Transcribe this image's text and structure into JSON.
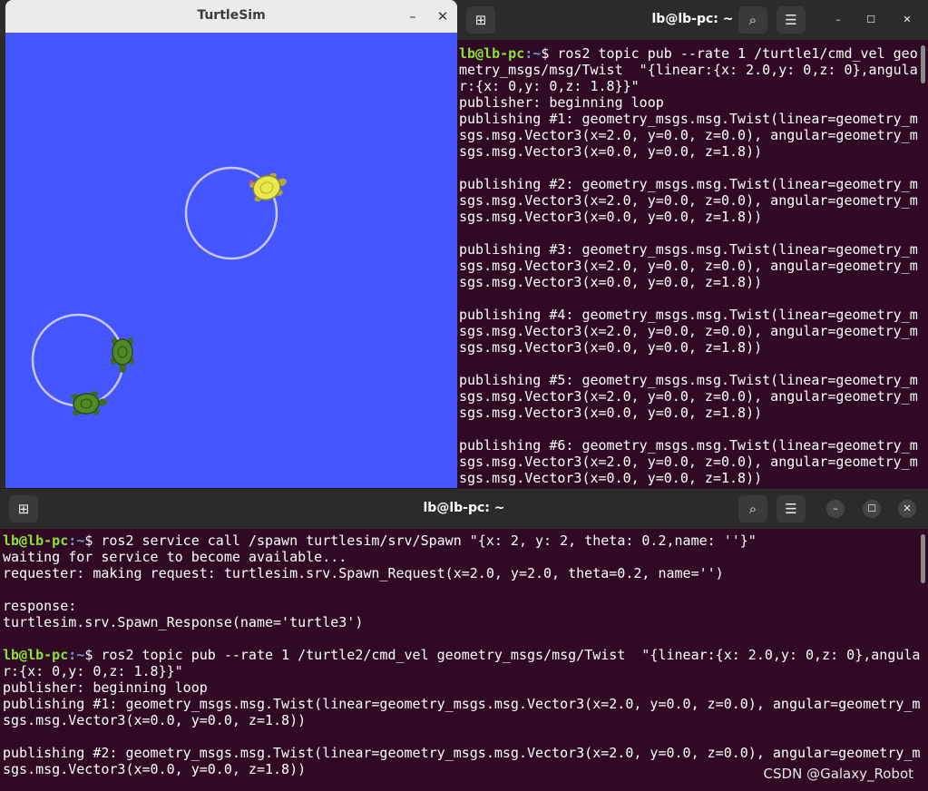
{
  "turtlesim": {
    "title": "TurtleSim",
    "minimize_icon": "minimize-icon",
    "close_icon": "close-icon",
    "background_color": "#4556ff",
    "trail_color": "#c8c8ff"
  },
  "terminal_top": {
    "title": "lb@lb-pc: ~",
    "prompt_user": "lb@lb-pc",
    "prompt_path": ":~",
    "prompt_symbol": "$ ",
    "command": "ros2 topic pub --rate 1 /turtle1/cmd_vel geo",
    "lines": [
      "metry_msgs/msg/Twist  \"{linear:{x: 2.0,y: 0,z: 0},angula",
      "r:{x: 0,y: 0,z: 1.8}}\"",
      "publisher: beginning loop",
      "publishing #1: geometry_msgs.msg.Twist(linear=geometry_m",
      "sgs.msg.Vector3(x=2.0, y=0.0, z=0.0), angular=geometry_m",
      "sgs.msg.Vector3(x=0.0, y=0.0, z=1.8))",
      "",
      "publishing #2: geometry_msgs.msg.Twist(linear=geometry_m",
      "sgs.msg.Vector3(x=2.0, y=0.0, z=0.0), angular=geometry_m",
      "sgs.msg.Vector3(x=0.0, y=0.0, z=1.8))",
      "",
      "publishing #3: geometry_msgs.msg.Twist(linear=geometry_m",
      "sgs.msg.Vector3(x=2.0, y=0.0, z=0.0), angular=geometry_m",
      "sgs.msg.Vector3(x=0.0, y=0.0, z=1.8))",
      "",
      "publishing #4: geometry_msgs.msg.Twist(linear=geometry_m",
      "sgs.msg.Vector3(x=2.0, y=0.0, z=0.0), angular=geometry_m",
      "sgs.msg.Vector3(x=0.0, y=0.0, z=1.8))",
      "",
      "publishing #5: geometry_msgs.msg.Twist(linear=geometry_m",
      "sgs.msg.Vector3(x=2.0, y=0.0, z=0.0), angular=geometry_m",
      "sgs.msg.Vector3(x=0.0, y=0.0, z=1.8))",
      "",
      "publishing #6: geometry_msgs.msg.Twist(linear=geometry_m",
      "sgs.msg.Vector3(x=2.0, y=0.0, z=0.0), angular=geometry_m",
      "sgs.msg.Vector3(x=0.0, y=0.0, z=1.8))"
    ],
    "icons": {
      "new_tab": "new-tab-icon",
      "search": "search-icon",
      "menu": "hamburger-menu-icon",
      "minimize": "minimize-icon",
      "maximize": "maximize-icon",
      "close": "close-icon"
    }
  },
  "terminal_bottom": {
    "title": "lb@lb-pc: ~",
    "prompt_user": "lb@lb-pc",
    "prompt_path": ":~",
    "prompt_symbol": "$ ",
    "command1": "ros2 service call /spawn turtlesim/srv/Spawn \"{x: 2, y: 2, theta: 0.2,name: ''}\"",
    "lines1": [
      "waiting for service to become available...",
      "requester: making request: turtlesim.srv.Spawn_Request(x=2.0, y=2.0, theta=0.2, name='')",
      "",
      "response:",
      "turtlesim.srv.Spawn_Response(name='turtle3')",
      ""
    ],
    "command2": "ros2 topic pub --rate 1 /turtle2/cmd_vel geometry_msgs/msg/Twist  \"{linear:{x: 2.0,y: 0,z: 0},angula",
    "lines2": [
      "r:{x: 0,y: 0,z: 1.8}}\"",
      "publisher: beginning loop",
      "publishing #1: geometry_msgs.msg.Twist(linear=geometry_msgs.msg.Vector3(x=2.0, y=0.0, z=0.0), angular=geometry_m",
      "sgs.msg.Vector3(x=0.0, y=0.0, z=1.8))",
      "",
      "publishing #2: geometry_msgs.msg.Twist(linear=geometry_msgs.msg.Vector3(x=2.0, y=0.0, z=0.0), angular=geometry_m",
      "sgs.msg.Vector3(x=0.0, y=0.0, z=1.8))"
    ]
  },
  "watermark": "CSDN @Galaxy_Robot"
}
